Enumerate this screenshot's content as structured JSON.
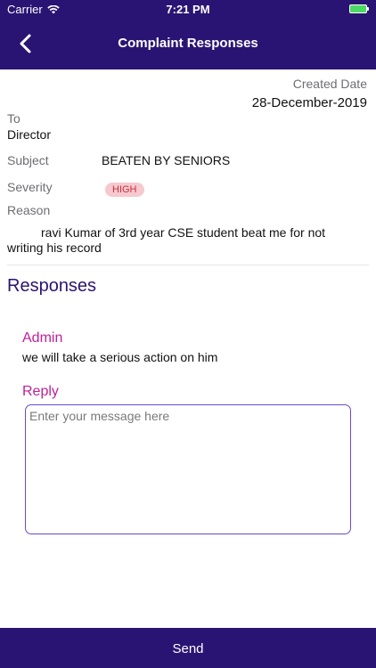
{
  "status_bar": {
    "carrier": "Carrier",
    "time": "7:21 PM"
  },
  "nav": {
    "title": "Complaint Responses",
    "back_icon": "chevron-left-icon"
  },
  "complaint": {
    "created_label": "Created Date",
    "created_value": "28-December-2019",
    "to_label": "To",
    "to_value": "Director",
    "subject_label": "Subject",
    "subject_value": "BEATEN BY SENIORS",
    "severity_label": "Severity",
    "severity_value": "HIGH",
    "reason_label": "Reason",
    "reason_value": "ravi Kumar of 3rd year CSE student beat me for not writing his record"
  },
  "responses": {
    "heading": "Responses",
    "items": [
      {
        "author": "Admin",
        "message": "we will take a serious action on him"
      }
    ]
  },
  "reply": {
    "label": "Reply",
    "placeholder": "Enter your message here",
    "value": ""
  },
  "send_button": {
    "label": "Send"
  },
  "colors": {
    "primary": "#2a1473",
    "accent": "#c0209a",
    "severity_bg": "#f6c9cf",
    "severity_text": "#c7313f",
    "input_border": "#6a4bc4"
  }
}
